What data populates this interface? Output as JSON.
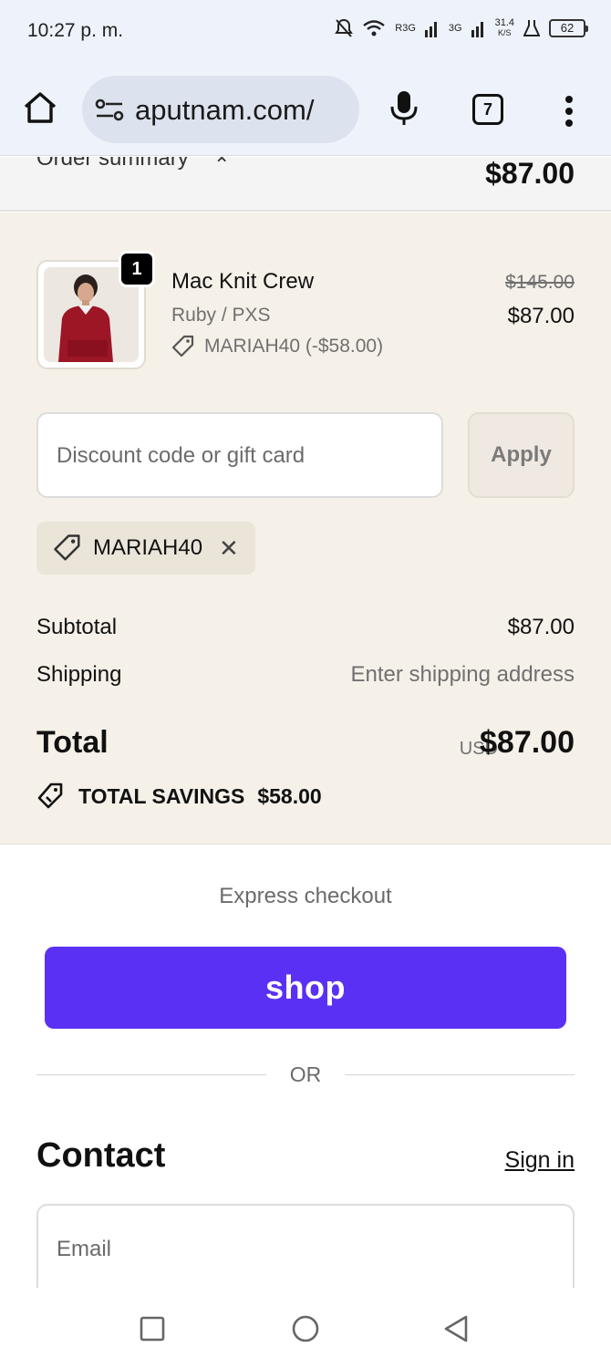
{
  "status_bar": {
    "time": "10:27 p. m.",
    "network_1": "R3G",
    "network_2": "3G",
    "speed": "31.4",
    "speed_unit": "K/S",
    "battery": "62"
  },
  "browser": {
    "url": "aputnam.com/",
    "tab_count": "7"
  },
  "summary_header": {
    "label": "Order summary",
    "total": "$87.00"
  },
  "line_item": {
    "quantity": "1",
    "name": "Mac Knit Crew",
    "variant": "Ruby / PXS",
    "discount": "MARIAH40 (-$58.00)",
    "original_price": "$145.00",
    "price": "$87.00"
  },
  "discount_form": {
    "placeholder": "Discount code or gift card",
    "apply_label": "Apply",
    "applied_code": "MARIAH40"
  },
  "totals": {
    "subtotal_label": "Subtotal",
    "subtotal_value": "$87.00",
    "shipping_label": "Shipping",
    "shipping_value": "Enter shipping address",
    "total_label": "Total",
    "currency": "USD",
    "total_value": "$87.00",
    "savings_label": "TOTAL SAVINGS",
    "savings_value": "$58.00"
  },
  "express": {
    "title": "Express checkout",
    "shop_label": "shop",
    "or_label": "OR"
  },
  "contact": {
    "title": "Contact",
    "signin_label": "Sign in",
    "email_placeholder": "Email"
  },
  "colors": {
    "shop_purple": "#5a31f4",
    "summary_bg": "#f5f0e8",
    "browser_bg": "#eef3fb"
  }
}
